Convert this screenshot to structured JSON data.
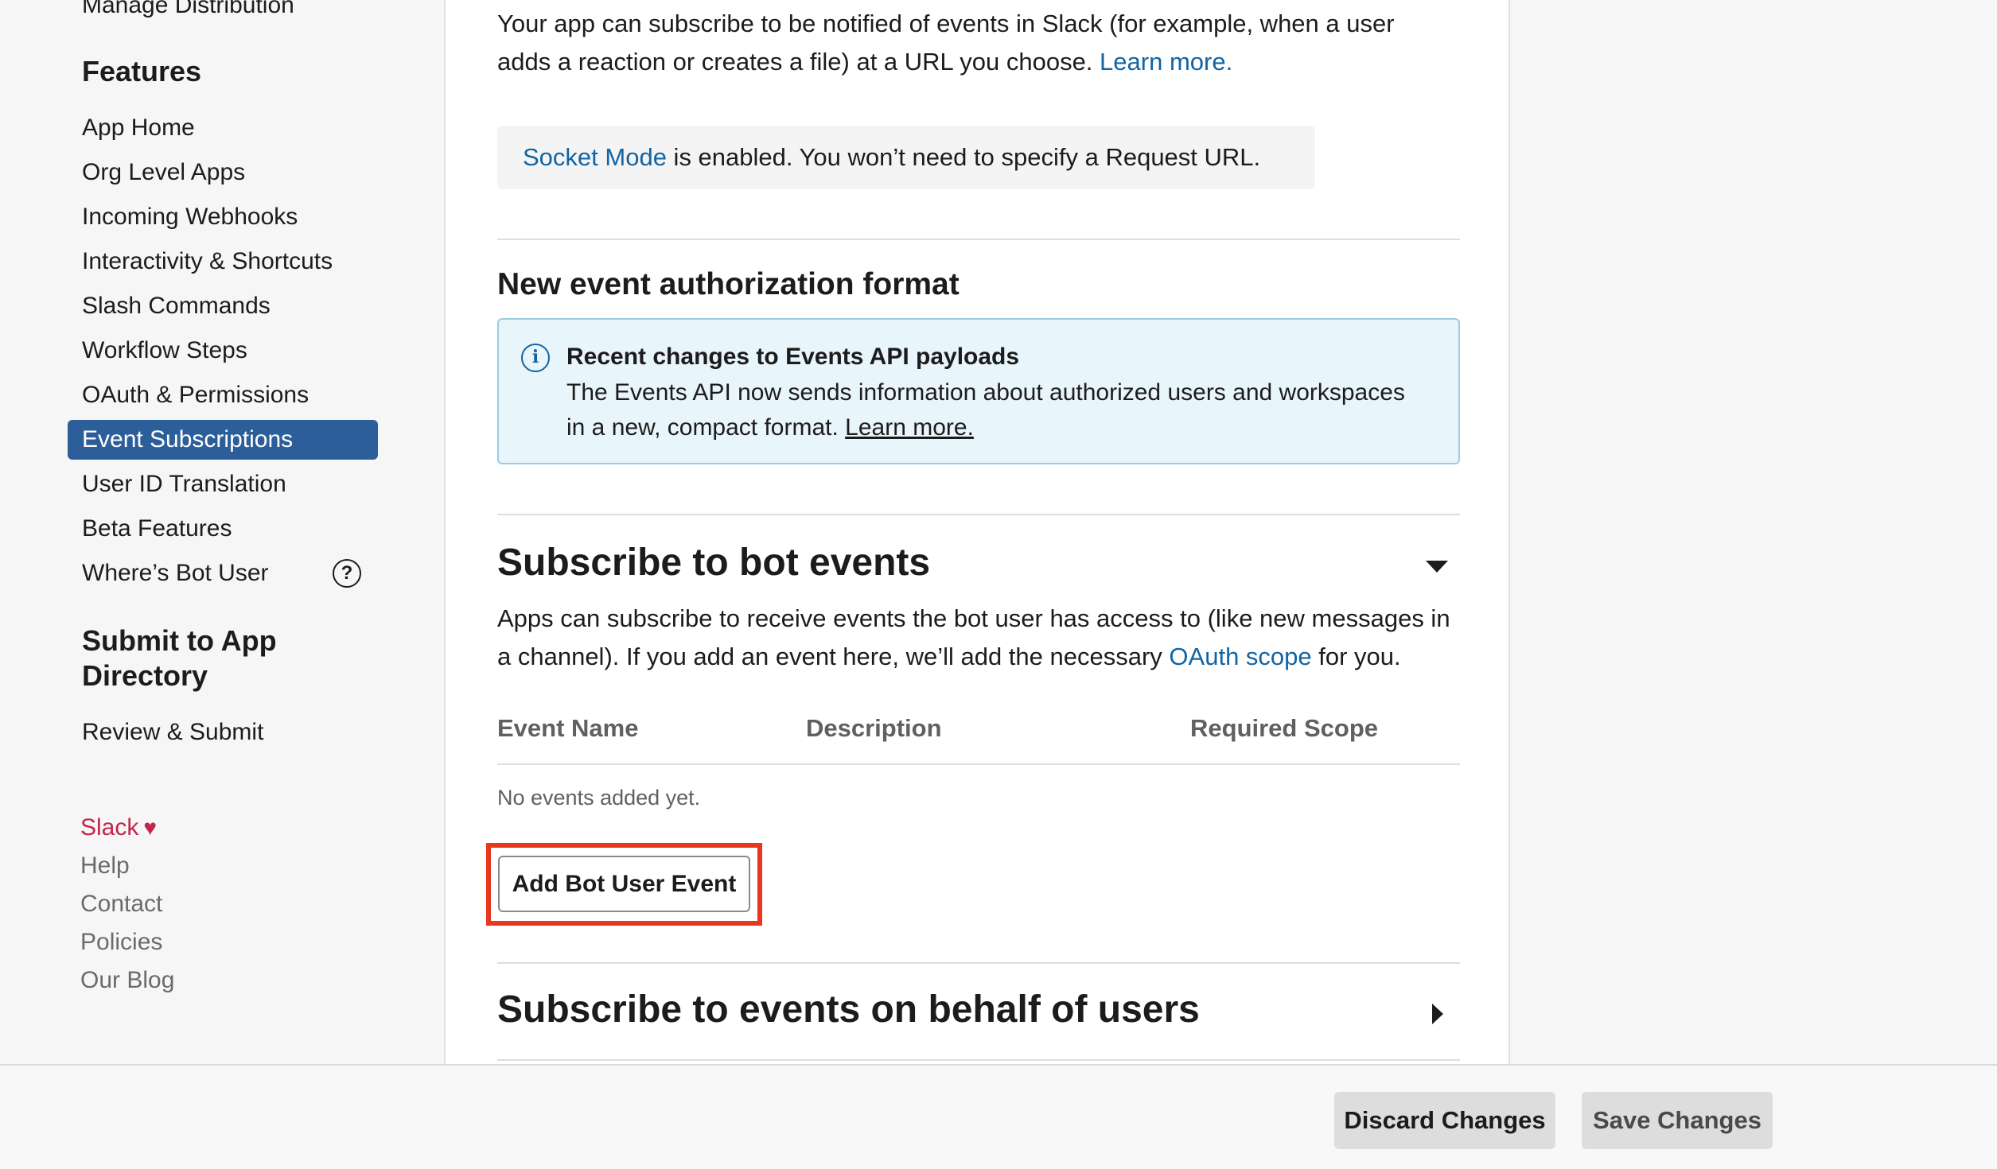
{
  "sidebar": {
    "top_item": "Manage Distribution",
    "features_heading": "Features",
    "items": [
      {
        "label": "App Home"
      },
      {
        "label": "Org Level Apps"
      },
      {
        "label": "Incoming Webhooks"
      },
      {
        "label": "Interactivity & Shortcuts"
      },
      {
        "label": "Slash Commands"
      },
      {
        "label": "Workflow Steps"
      },
      {
        "label": "OAuth & Permissions"
      },
      {
        "label": "Event Subscriptions"
      },
      {
        "label": "User ID Translation"
      },
      {
        "label": "Beta Features"
      },
      {
        "label": "Where’s Bot User"
      }
    ],
    "help_icon_glyph": "?",
    "submit_heading_line1": "Submit to App",
    "submit_heading_line2": "Directory",
    "review_item": "Review & Submit",
    "footer_links": {
      "slack": "Slack",
      "help": "Help",
      "contact": "Contact",
      "policies": "Policies",
      "blog": "Our Blog"
    }
  },
  "main": {
    "intro_text_line1": "Your app can subscribe to be notified of events in Slack (for example, when a user",
    "intro_text_line2": "adds a reaction or creates a file) at a URL you choose.",
    "intro_link": "Learn more.",
    "socket_link": "Socket Mode",
    "socket_text": " is enabled. You won’t need to specify a Request URL.",
    "auth_heading": "New event authorization format",
    "info": {
      "title": "Recent changes to Events API payloads",
      "body": "The Events API now sends information about authorized users and workspaces in a new, compact format. ",
      "link": "Learn more."
    },
    "bot_heading": "Subscribe to bot events",
    "bot_desc_line1": "Apps can subscribe to receive events the bot user has access to (like new messages in",
    "bot_desc_line2_a": "a channel). If you add an event here, we’ll add the necessary ",
    "bot_desc_link": "OAuth scope",
    "bot_desc_line2_b": " for you.",
    "table_headers": [
      "Event Name",
      "Description",
      "Required Scope"
    ],
    "empty_text": "No events added yet.",
    "add_button": "Add Bot User Event",
    "users_heading": "Subscribe to events on behalf of users"
  },
  "footer": {
    "discard": "Discard Changes",
    "save": "Save Changes"
  },
  "colors": {
    "active_nav": "#2c5e99",
    "link": "#1264a3",
    "slack_pink": "#c4264d",
    "highlight": "#e8371f"
  }
}
